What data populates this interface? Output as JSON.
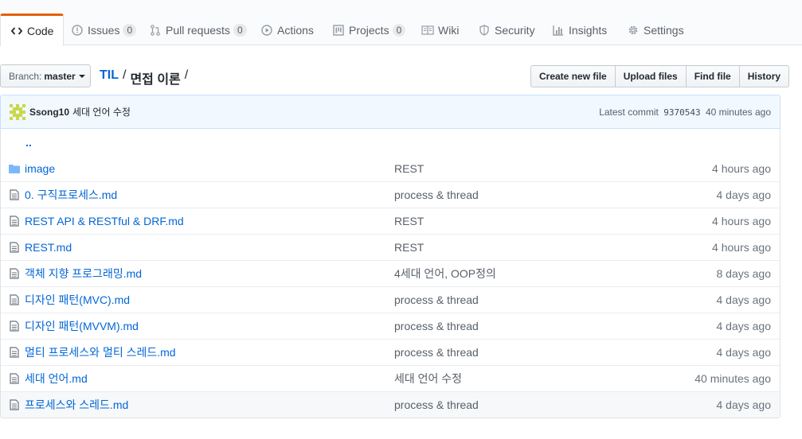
{
  "tabs": [
    {
      "label": "Code",
      "icon": "code-icon",
      "selected": true
    },
    {
      "label": "Issues",
      "icon": "issue-icon",
      "count": "0"
    },
    {
      "label": "Pull requests",
      "icon": "pull-request-icon",
      "count": "0"
    },
    {
      "label": "Actions",
      "icon": "play-icon"
    },
    {
      "label": "Projects",
      "icon": "project-icon",
      "count": "0"
    },
    {
      "label": "Wiki",
      "icon": "book-icon"
    },
    {
      "label": "Security",
      "icon": "shield-icon"
    },
    {
      "label": "Insights",
      "icon": "graph-icon"
    },
    {
      "label": "Settings",
      "icon": "gear-icon"
    }
  ],
  "branch": {
    "label": "Branch:",
    "name": "master"
  },
  "breadcrumb": {
    "repo": "TIL",
    "sep": "/",
    "folder": "면접 이론",
    "trail": "/"
  },
  "actions": {
    "create": "Create new file",
    "upload": "Upload files",
    "find": "Find file",
    "history": "History"
  },
  "commit": {
    "author": "Ssong10",
    "message": "세대 언어 수정",
    "latest_label": "Latest commit",
    "sha": "9370543",
    "age": "40 minutes ago"
  },
  "parent_dir": "..",
  "files": [
    {
      "type": "dir",
      "name": "image",
      "message": "REST",
      "age": "4 hours ago"
    },
    {
      "type": "file",
      "name": "0. 구직프로세스.md",
      "message": "process & thread",
      "age": "4 days ago"
    },
    {
      "type": "file",
      "name": "REST API & RESTful & DRF.md",
      "message": "REST",
      "age": "4 hours ago"
    },
    {
      "type": "file",
      "name": "REST.md",
      "message": "REST",
      "age": "4 hours ago"
    },
    {
      "type": "file",
      "name": "객체 지향 프로그래밍.md",
      "message": "4세대 언어, OOP정의",
      "age": "8 days ago"
    },
    {
      "type": "file",
      "name": "디자인 패턴(MVC).md",
      "message": "process & thread",
      "age": "4 days ago"
    },
    {
      "type": "file",
      "name": "디자인 패턴(MVVM).md",
      "message": "process & thread",
      "age": "4 days ago"
    },
    {
      "type": "file",
      "name": "멀티 프로세스와 멀티 스레드.md",
      "message": "process & thread",
      "age": "4 days ago"
    },
    {
      "type": "file",
      "name": "세대 언어.md",
      "message": "세대 언어 수정",
      "age": "40 minutes ago"
    },
    {
      "type": "file",
      "name": "프로세스와 스레드.md",
      "message": "process & thread",
      "age": "4 days ago"
    }
  ],
  "colors": {
    "link": "#0366d6",
    "tab_accent": "#e36209",
    "commit_bg": "#f1f8ff",
    "commit_border": "#c8e1ff",
    "folder": "#79b8ff"
  }
}
